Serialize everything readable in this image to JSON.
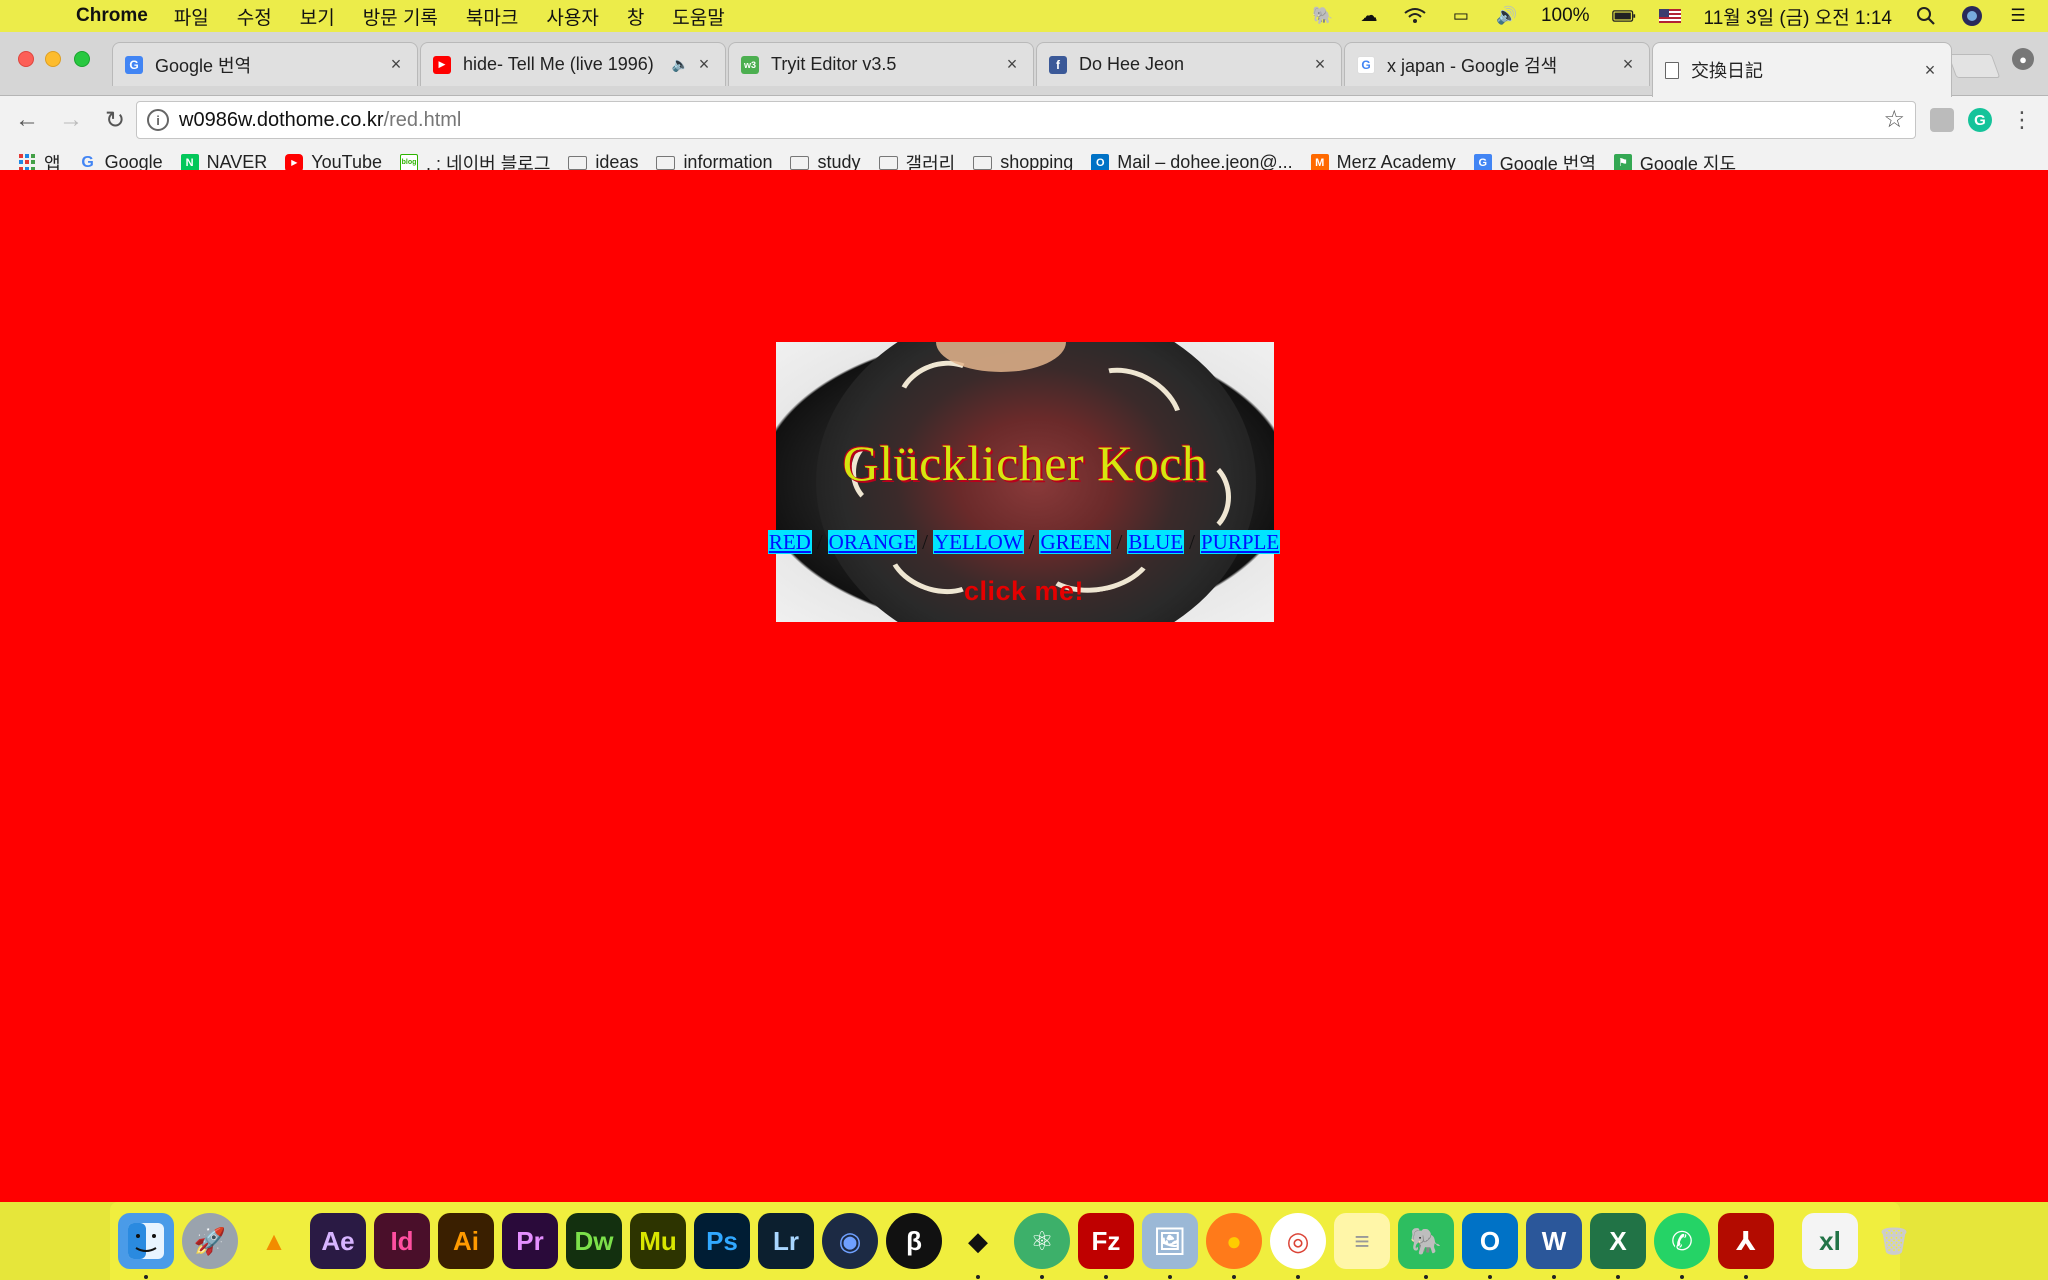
{
  "menubar": {
    "app_name": "Chrome",
    "items": [
      "파일",
      "수정",
      "보기",
      "방문 기록",
      "북마크",
      "사용자",
      "창",
      "도움말"
    ],
    "battery": "100%",
    "datetime": "11월 3일 (금) 오전 1:14"
  },
  "tabs": [
    {
      "title": "Google 번역",
      "favicon_color": "#4285f4",
      "favicon": "G"
    },
    {
      "title": "hide- Tell Me (live 1996)",
      "favicon_color": "#ff0000",
      "favicon": "▶"
    },
    {
      "title": "Tryit Editor v3.5",
      "favicon_color": "#4caf50",
      "favicon": "w3"
    },
    {
      "title": "Do Hee Jeon",
      "favicon_color": "#3b5998",
      "favicon": "f"
    },
    {
      "title": "x japan - Google 검색",
      "favicon_color": "#ffffff",
      "favicon": "G"
    },
    {
      "title": "交換日記",
      "favicon_color": "#ffffff",
      "favicon": ""
    }
  ],
  "address": {
    "host": "w0986w.dothome.co.kr",
    "path": "/red.html"
  },
  "bookmarks": [
    {
      "label": "앱",
      "icon": "apps-grid-icon"
    },
    {
      "label": "Google",
      "icon": "google-icon"
    },
    {
      "label": "NAVER",
      "icon": "naver-icon"
    },
    {
      "label": "YouTube",
      "icon": "youtube-icon"
    },
    {
      "label": ". : 네이버 블로그",
      "icon": "blog-icon"
    },
    {
      "label": "ideas",
      "icon": "folder-icon"
    },
    {
      "label": "information",
      "icon": "folder-icon"
    },
    {
      "label": "study",
      "icon": "folder-icon"
    },
    {
      "label": "갤러리",
      "icon": "folder-icon"
    },
    {
      "label": "shopping",
      "icon": "folder-icon"
    },
    {
      "label": "Mail – dohee.jeon@...",
      "icon": "outlook-icon"
    },
    {
      "label": "Merz Academy",
      "icon": "merz-icon"
    },
    {
      "label": "Google 번역",
      "icon": "translate-icon"
    },
    {
      "label": "Google 지도",
      "icon": "maps-icon"
    }
  ],
  "page": {
    "background": "#ff0000",
    "hero_title": "Glücklicher Koch",
    "nav_links": [
      "RED",
      "ORANGE",
      "YELLOW",
      "GREEN",
      "BLUE",
      "PURPLE"
    ],
    "separator": "/",
    "click_me": "click me!"
  },
  "dock": [
    {
      "name": "finder-icon",
      "label": "",
      "bg": "#4a9be8",
      "fg": "#fff"
    },
    {
      "name": "launchpad-icon",
      "label": "🚀",
      "bg": "#9aa3ad",
      "fg": "#fff"
    },
    {
      "name": "vlc-icon",
      "label": "▲",
      "bg": "transparent",
      "fg": "#f28c00"
    },
    {
      "name": "after-effects-icon",
      "label": "Ae",
      "bg": "#2a1a44",
      "fg": "#d7b4ff"
    },
    {
      "name": "indesign-icon",
      "label": "Id",
      "bg": "#4a0f2a",
      "fg": "#ff4fa0"
    },
    {
      "name": "illustrator-icon",
      "label": "Ai",
      "bg": "#3a1f00",
      "fg": "#ff9a00"
    },
    {
      "name": "premiere-icon",
      "label": "Pr",
      "bg": "#2a0a3a",
      "fg": "#e48fff"
    },
    {
      "name": "dreamweaver-icon",
      "label": "Dw",
      "bg": "#13300f",
      "fg": "#7ce04a"
    },
    {
      "name": "muse-icon",
      "label": "Mu",
      "bg": "#2d3400",
      "fg": "#d9e600"
    },
    {
      "name": "photoshop-icon",
      "label": "Ps",
      "bg": "#001d34",
      "fg": "#31a8ff"
    },
    {
      "name": "lightroom-icon",
      "label": "Lr",
      "bg": "#0c1f2f",
      "fg": "#a9d6ff"
    },
    {
      "name": "cinema4d-icon",
      "label": "◉",
      "bg": "#1c2a44",
      "fg": "#6fa0ff"
    },
    {
      "name": "brackets-icon",
      "label": "β",
      "bg": "#111",
      "fg": "#fff"
    },
    {
      "name": "unity-icon",
      "label": "◆",
      "bg": "transparent",
      "fg": "#111"
    },
    {
      "name": "atom-icon",
      "label": "⚛",
      "bg": "#3db06a",
      "fg": "#fff"
    },
    {
      "name": "filezilla-icon",
      "label": "Fz",
      "bg": "#bf0000",
      "fg": "#fff"
    },
    {
      "name": "preview-icon",
      "label": "🖼",
      "bg": "#9bb8d6",
      "fg": "#fff"
    },
    {
      "name": "firefox-icon",
      "label": "●",
      "bg": "#ff7a1a",
      "fg": "#ffcc00"
    },
    {
      "name": "chrome-icon",
      "label": "◎",
      "bg": "#ffffff",
      "fg": "#db4437"
    },
    {
      "name": "notes-icon",
      "label": "≡",
      "bg": "#fff6a8",
      "fg": "#999"
    },
    {
      "name": "evernote-icon",
      "label": "🐘",
      "bg": "#2dbe60",
      "fg": "#fff"
    },
    {
      "name": "outlook-icon",
      "label": "O",
      "bg": "#0072c6",
      "fg": "#fff"
    },
    {
      "name": "word-icon",
      "label": "W",
      "bg": "#2b579a",
      "fg": "#fff"
    },
    {
      "name": "excel-icon",
      "label": "X",
      "bg": "#217346",
      "fg": "#fff"
    },
    {
      "name": "whatsapp-icon",
      "label": "✆",
      "bg": "#25d366",
      "fg": "#fff"
    },
    {
      "name": "acrobat-icon",
      "label": "⅄",
      "bg": "#b30b00",
      "fg": "#fff"
    }
  ],
  "dock_right": [
    {
      "name": "excel-document-icon",
      "label": "xl",
      "bg": "#f4f4f4",
      "fg": "#217346"
    },
    {
      "name": "trash-icon",
      "label": "🗑",
      "bg": "transparent",
      "fg": "#ccc"
    }
  ]
}
